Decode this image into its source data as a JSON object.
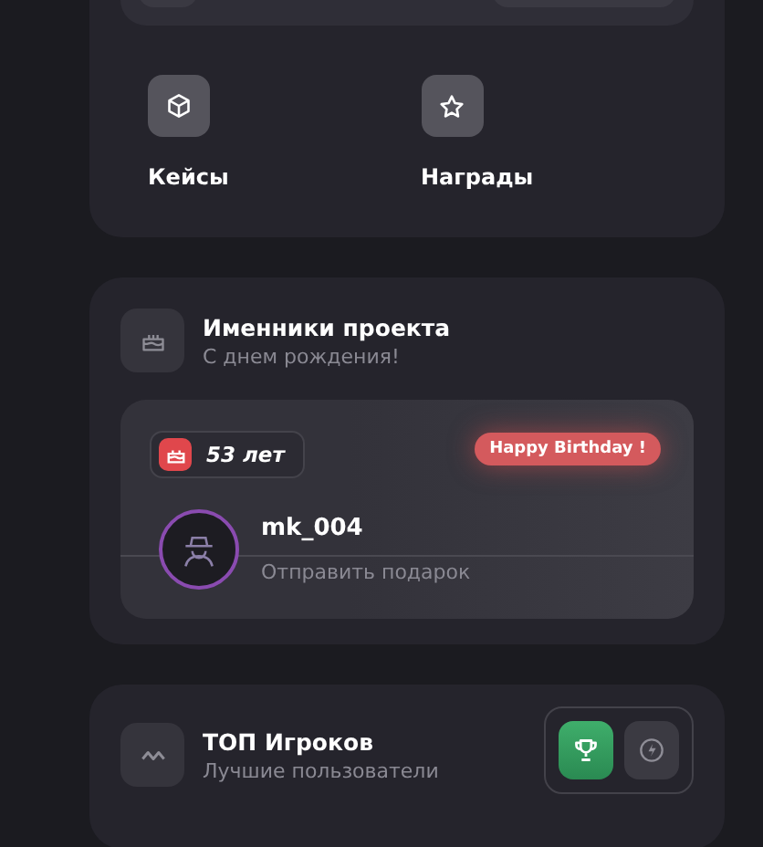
{
  "shortcuts": [
    {
      "kind": "box",
      "label": "Кейсы"
    },
    {
      "kind": "star",
      "label": "Награды"
    }
  ],
  "birthdays": {
    "title": "Именники проекта",
    "subtitle": "С днем рождения!",
    "age": "53 лет",
    "badge": "Happy Birthday !",
    "user": {
      "name": "mk_004",
      "action": "Отправить подарок"
    }
  },
  "top_players": {
    "title": "ТОП Игроков",
    "subtitle": "Лучшие пользователи",
    "tabs": [
      {
        "kind": "trophy",
        "selected": true
      },
      {
        "kind": "bolt",
        "selected": false
      }
    ]
  }
}
